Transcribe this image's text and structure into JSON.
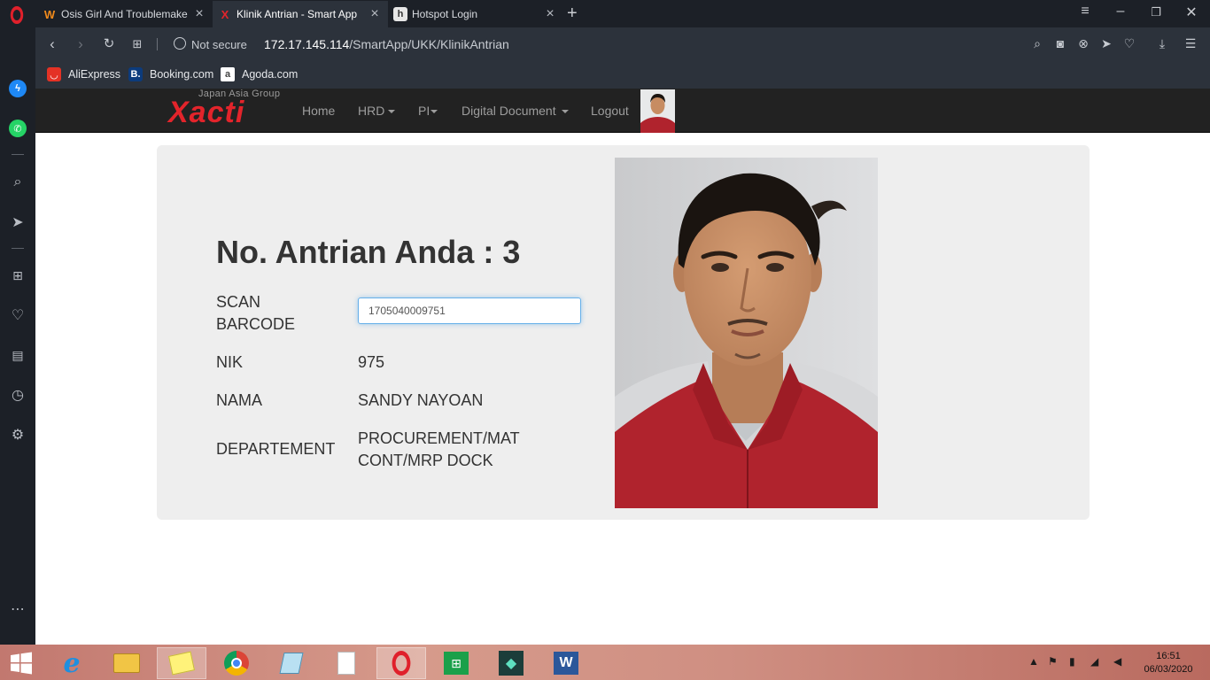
{
  "browser": {
    "tabs": [
      {
        "title": "Osis Girl And Troublemake",
        "favicon": "W"
      },
      {
        "title": "Klinik Antrian - Smart App",
        "favicon": "X"
      },
      {
        "title": "Hotspot Login",
        "favicon": "h"
      }
    ],
    "address": {
      "security": "Not secure",
      "host": "172.17.145.114",
      "path": "/SmartApp/UKK/KlinikAntrian"
    },
    "bookmarks": [
      {
        "label": "AliExpress",
        "icon": "aliexpress-icon",
        "color": "#e43225"
      },
      {
        "label": "Booking.com",
        "icon": "booking-icon",
        "color": "#0c3b7c"
      },
      {
        "label": "Agoda.com",
        "icon": "agoda-icon",
        "color": "#ffffff"
      }
    ]
  },
  "site": {
    "brand_tagline": "Japan Asia Group",
    "brand": "Xacti",
    "nav": {
      "home": "Home",
      "hrd": "HRD",
      "pi": "PI",
      "digital_document": "Digital Document",
      "logout": "Logout"
    }
  },
  "queue": {
    "title": "No. Antrian Anda : ",
    "number": "3",
    "scan_label": "SCAN BARCODE",
    "scan_value": "1705040009751",
    "nik_label": "NIK",
    "nik_value": "975",
    "nama_label": "NAMA",
    "nama_value": "SANDY NAYOAN",
    "dept_label": "DEPARTEMENT",
    "dept_value": "PROCUREMENT/MAT CONT/MRP DOCK"
  },
  "taskbar": {
    "time": "16:51",
    "date": "06/03/2020"
  },
  "colors": {
    "brand_red": "#e3242b",
    "navbar": "#222222",
    "card": "#eeeeee",
    "shirt": "#b0232d"
  }
}
